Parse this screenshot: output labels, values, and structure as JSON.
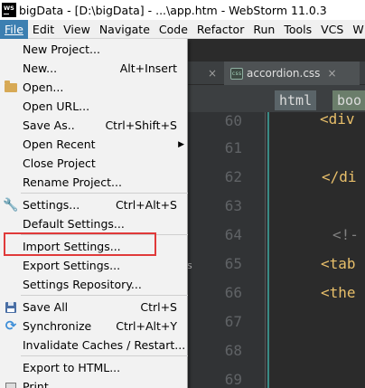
{
  "window": {
    "logo_text": [
      "WS"
    ],
    "title": "bigData - [D:\\bigData] - ...\\app.htm - WebStorm 11.0.3"
  },
  "menubar": {
    "items": [
      "File",
      "Edit",
      "View",
      "Navigate",
      "Code",
      "Refactor",
      "Run",
      "Tools",
      "VCS",
      "W"
    ]
  },
  "file_menu": {
    "new_project": "New Project...",
    "new": "New...",
    "new_shortcut": "Alt+Insert",
    "open": "Open...",
    "open_url": "Open URL...",
    "save_as": "Save As..",
    "save_as_shortcut": "Ctrl+Shift+S",
    "open_recent": "Open Recent",
    "close_project": "Close Project",
    "rename_project": "Rename Project...",
    "settings": "Settings...",
    "settings_shortcut": "Ctrl+Alt+S",
    "default_settings": "Default Settings...",
    "import_settings": "Import Settings...",
    "export_settings": "Export Settings...",
    "settings_repository": "Settings Repository...",
    "save_all": "Save All",
    "save_all_shortcut": "Ctrl+S",
    "synchronize": "Synchronize",
    "synchronize_shortcut": "Ctrl+Alt+Y",
    "invalidate_caches": "Invalidate Caches / Restart...",
    "export_html": "Export to HTML...",
    "print": "Print..."
  },
  "editor": {
    "tab_label": "accordion.css",
    "crumb_html": "html",
    "crumb_body": "boo",
    "line_numbers": [
      "60",
      "61",
      "62",
      "63",
      "64",
      "65",
      "66",
      "67",
      "68",
      "69"
    ],
    "code_lines": [
      "<div",
      "",
      "</di",
      "",
      "<!-",
      "<tab",
      "<the",
      "",
      "",
      ""
    ]
  },
  "side_label": "s"
}
